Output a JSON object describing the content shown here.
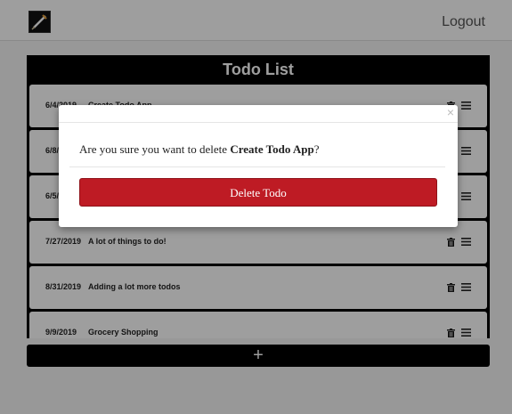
{
  "nav": {
    "logo_icon": "pencil-logo-icon",
    "logout_label": "Logout"
  },
  "todo": {
    "title": "Todo List",
    "items": [
      {
        "date": "6/4/2019",
        "text": "Create Todo App"
      },
      {
        "date": "6/8/2019",
        "text": ""
      },
      {
        "date": "6/5/2019",
        "text": ""
      },
      {
        "date": "7/27/2019",
        "text": "A lot of things to do!"
      },
      {
        "date": "8/31/2019",
        "text": "Adding a lot more todos"
      },
      {
        "date": "9/9/2019",
        "text": "Grocery Shopping"
      }
    ],
    "item_icons": [
      "trash-icon",
      "drag-handle-icon"
    ],
    "add_label": "+"
  },
  "modal": {
    "close_label": "×",
    "prompt_prefix": "Are you sure you want to delete ",
    "target": "Create Todo App",
    "prompt_suffix": "?",
    "delete_label": "Delete Todo",
    "delete_color": "#be1b24"
  }
}
